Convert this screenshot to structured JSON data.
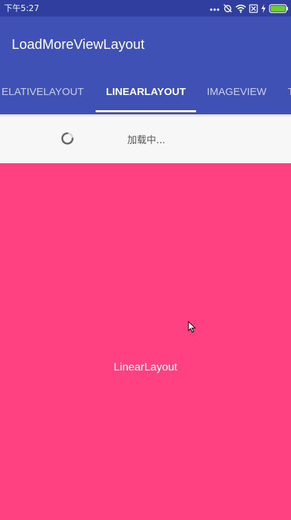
{
  "status_bar": {
    "time": "下午5:27",
    "icons": [
      "more-dots-icon",
      "alarm-off-icon",
      "wifi-icon",
      "sim-off-icon",
      "charging-icon",
      "battery-icon"
    ]
  },
  "app_bar": {
    "title": "LoadMoreViewLayout"
  },
  "tabs": [
    {
      "label": "ELATIVELAYOUT",
      "active": false
    },
    {
      "label": "LINEARLAYOUT",
      "active": true
    },
    {
      "label": "IMAGEVIEW",
      "active": false
    },
    {
      "label": "T",
      "active": false
    }
  ],
  "loading": {
    "text": "加载中..."
  },
  "content": {
    "label": "LinearLayout"
  },
  "colors": {
    "primary": "#3f51b5",
    "primary_dark": "#303f9f",
    "accent": "#ff4081",
    "loading_bg": "#f7f7f7"
  }
}
